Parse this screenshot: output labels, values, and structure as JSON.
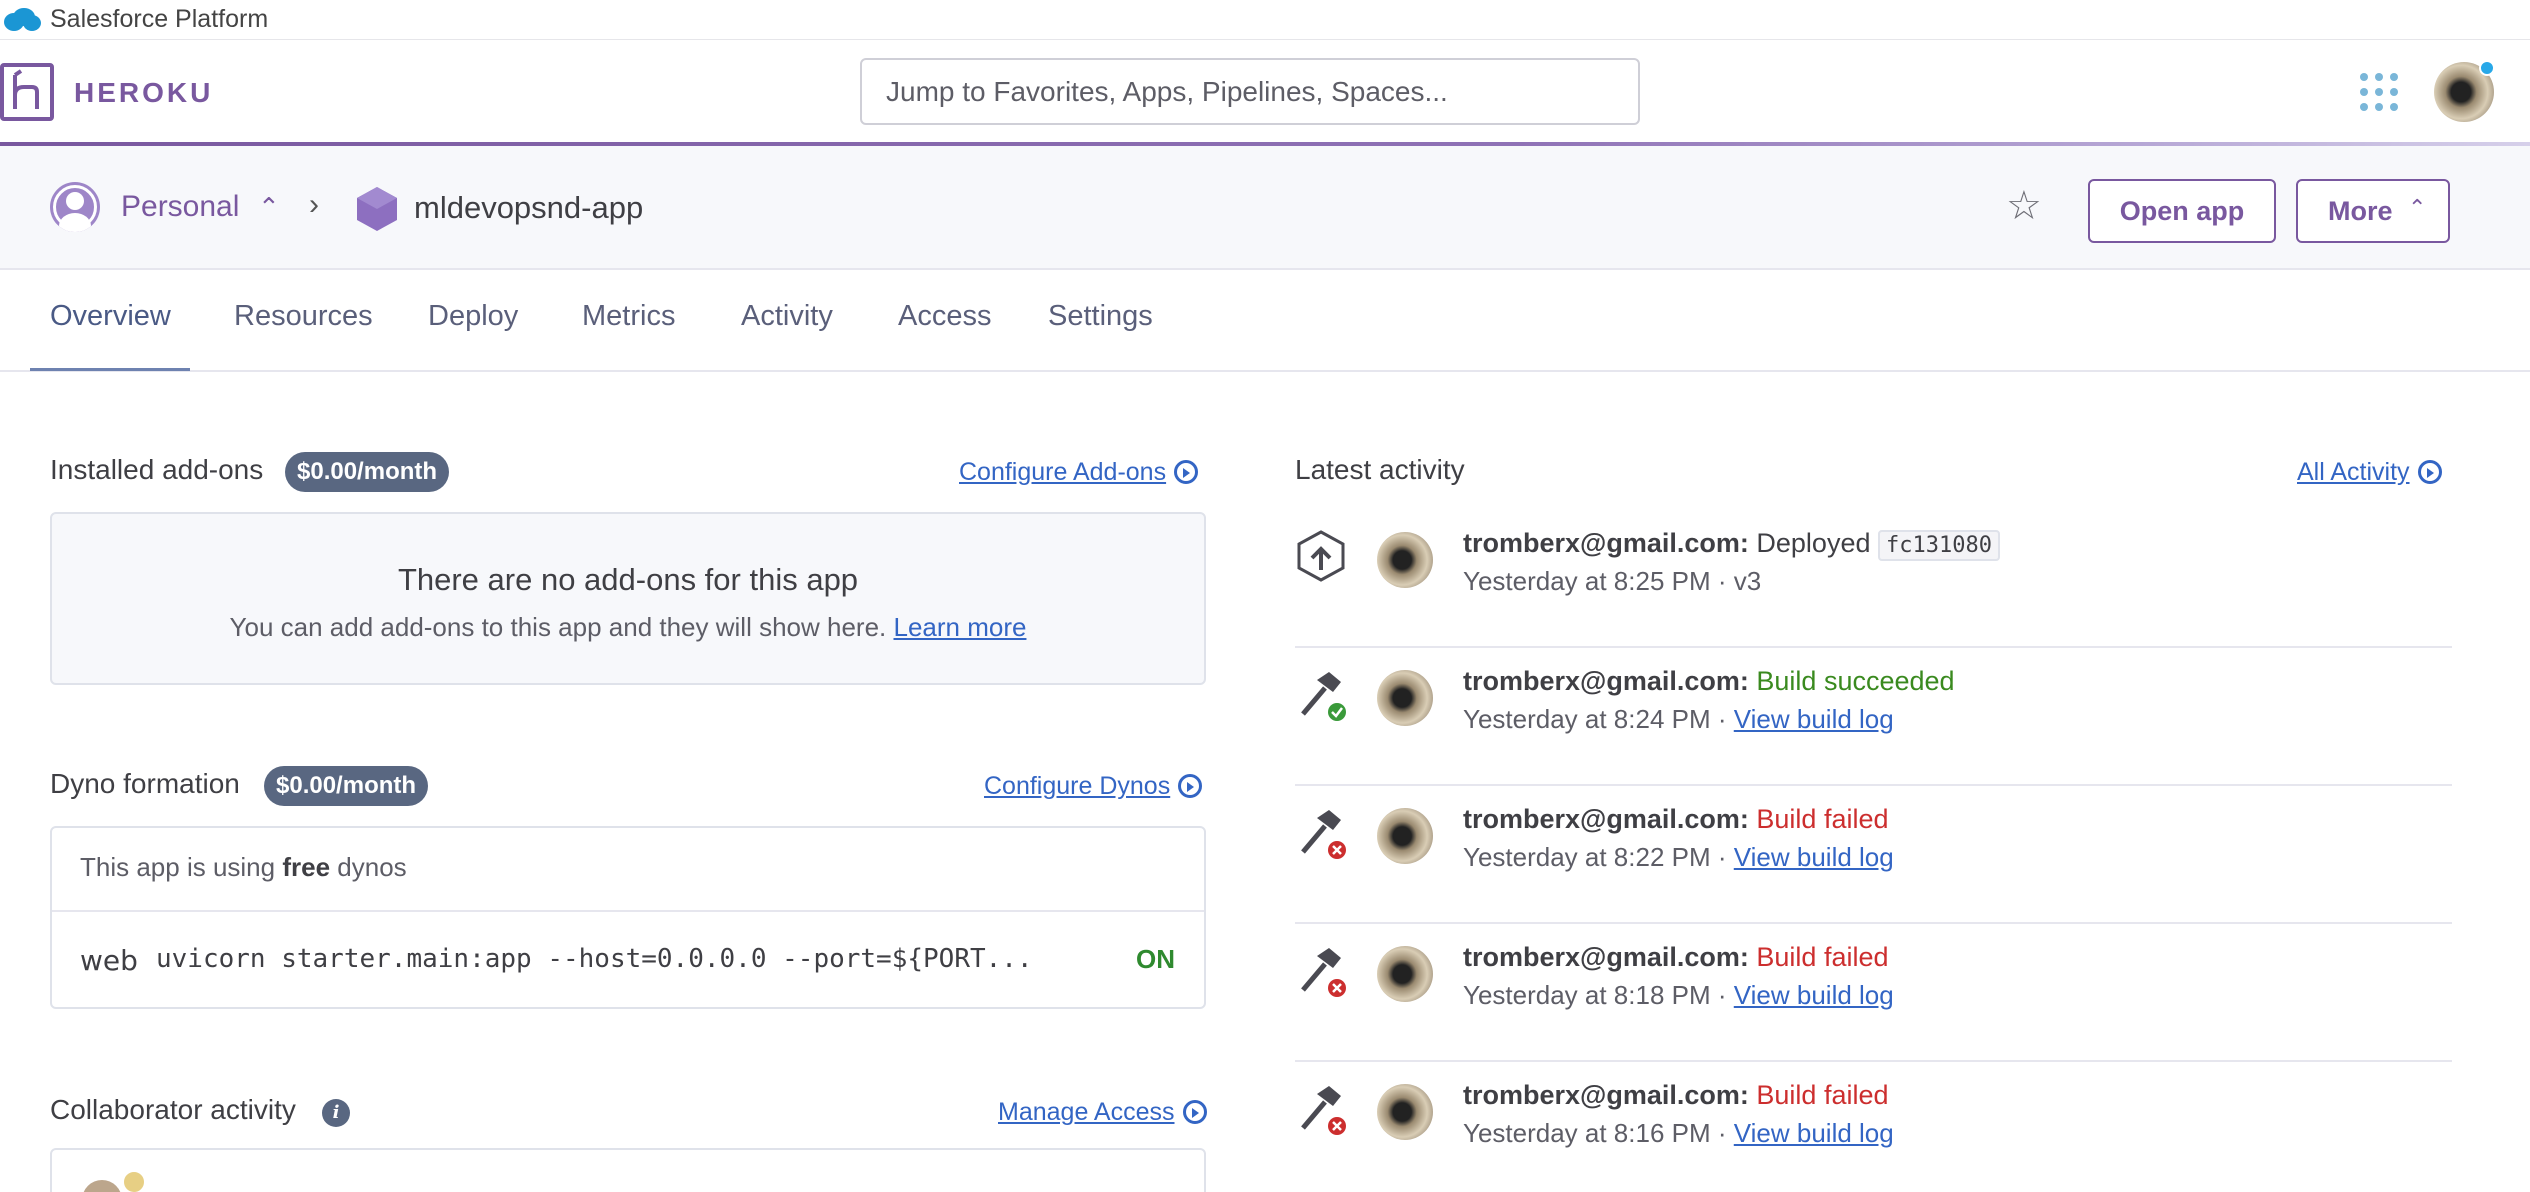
{
  "salesforce": {
    "title": "Salesforce Platform"
  },
  "header": {
    "brand": "HEROKU",
    "search_placeholder": "Jump to Favorites, Apps, Pipelines, Spaces..."
  },
  "app_bar": {
    "team": "Personal",
    "app_name": "mldevopsnd-app",
    "open_app": "Open app",
    "more": "More"
  },
  "tabs": [
    {
      "label": "Overview",
      "active": true
    },
    {
      "label": "Resources"
    },
    {
      "label": "Deploy"
    },
    {
      "label": "Metrics"
    },
    {
      "label": "Activity"
    },
    {
      "label": "Access"
    },
    {
      "label": "Settings"
    }
  ],
  "addons": {
    "title": "Installed add-ons",
    "price": "$0.00/month",
    "configure_link": "Configure Add-ons",
    "empty_title": "There are no add-ons for this app",
    "empty_sub": "You can add add-ons to this app and they will show here.",
    "learn_more": "Learn more"
  },
  "dynos": {
    "title": "Dyno formation",
    "price": "$0.00/month",
    "configure_link": "Configure Dynos",
    "free_prefix": "This app is using",
    "free_bold": "free",
    "free_suffix": "dynos",
    "process": {
      "type": "web",
      "command": "uvicorn starter.main:app --host=0.0.0.0 --port=${PORT...",
      "state": "ON"
    }
  },
  "collaborators": {
    "title": "Collaborator activity",
    "manage_link": "Manage Access"
  },
  "activity": {
    "title": "Latest activity",
    "all_link": "All Activity",
    "items": [
      {
        "user": "tromberx@gmail.com:",
        "action": "Deployed",
        "commit": "fc131080",
        "time": "Yesterday at 8:25 PM · v3",
        "icon": "deploy-icon"
      },
      {
        "user": "tromberx@gmail.com:",
        "action": "Build succeeded",
        "time": "Yesterday at 8:24 PM ·",
        "link": "View build log",
        "icon": "build-success-icon"
      },
      {
        "user": "tromberx@gmail.com:",
        "action": "Build failed",
        "time": "Yesterday at 8:22 PM ·",
        "link": "View build log",
        "icon": "build-failed-icon"
      },
      {
        "user": "tromberx@gmail.com:",
        "action": "Build failed",
        "time": "Yesterday at 8:18 PM ·",
        "link": "View build log",
        "icon": "build-failed-icon"
      },
      {
        "user": "tromberx@gmail.com:",
        "action": "Build failed",
        "time": "Yesterday at 8:16 PM ·",
        "link": "View build log",
        "icon": "build-failed-icon"
      }
    ]
  },
  "colors": {
    "brand_purple": "#79589f",
    "link_blue": "#3365c4",
    "success_green": "#3a8a1f",
    "fail_red": "#cc2e2e",
    "badge_slate": "#596781"
  }
}
